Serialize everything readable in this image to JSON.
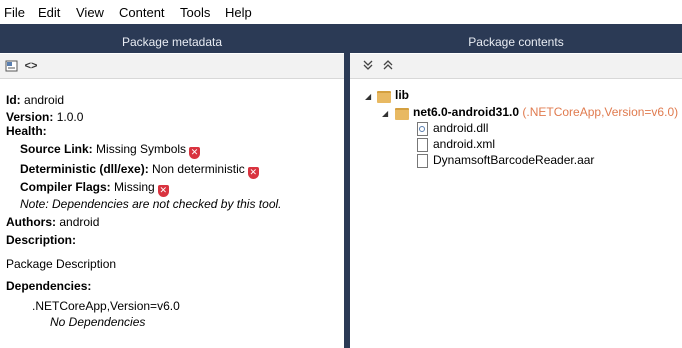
{
  "menu": [
    "File",
    "Edit",
    "View",
    "Content",
    "Tools",
    "Help"
  ],
  "left_pane": {
    "title": "Package metadata",
    "id_label": "Id:",
    "id_value": "android",
    "version_label": "Version:",
    "version_value": "1.0.0",
    "health_label": "Health:",
    "source_link_label": "Source Link:",
    "source_link_value": "Missing Symbols",
    "deterministic_label": "Deterministic (dll/exe):",
    "deterministic_value": "Non deterministic",
    "compiler_flags_label": "Compiler Flags:",
    "compiler_flags_value": "Missing",
    "note": "Note: Dependencies are not checked by this tool.",
    "authors_label": "Authors:",
    "authors_value": "android",
    "description_label": "Description:",
    "description_value": "Package Description",
    "dependencies_label": "Dependencies:",
    "dependency_group": ".NETCoreApp,Version=v6.0",
    "no_dependencies": "No Dependencies"
  },
  "right_pane": {
    "title": "Package contents",
    "lib_folder": "lib",
    "framework_folder": "net6.0-android31.0",
    "framework_name": "(.NETCoreApp,Version=v6.0)",
    "files": [
      "android.dll",
      "android.xml",
      "DynamsoftBarcodeReader.aar"
    ]
  },
  "colors": {
    "header_bg": "#2b3a55",
    "warning": "#d9333f",
    "framework_accent": "#e07b4f"
  }
}
